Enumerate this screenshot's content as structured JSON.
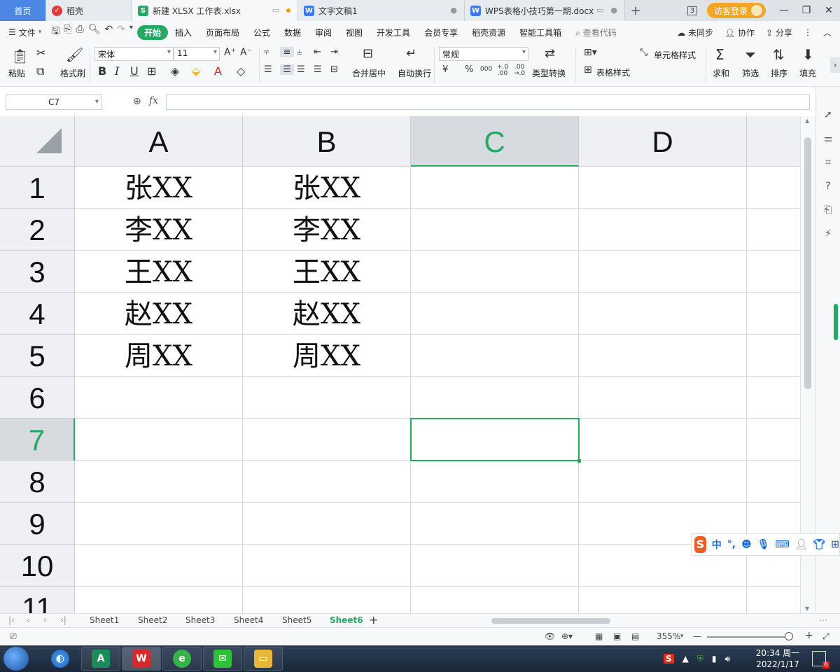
{
  "tabs": [
    {
      "label": "首页",
      "icon": "home-icon"
    },
    {
      "label": "稻壳",
      "icon": "daoke-icon"
    },
    {
      "label": "新建 XLSX 工作表.xlsx",
      "icon": "sheet-s-icon"
    },
    {
      "label": "文字文稿1",
      "icon": "writer-w-icon"
    },
    {
      "label": "WPS表格小技巧第一期.docx",
      "icon": "writer-w-icon"
    }
  ],
  "tabbar": {
    "window_count": "3",
    "login_label": "访客登录"
  },
  "menu": {
    "file_label": "文件",
    "items": [
      "开始",
      "插入",
      "页面布局",
      "公式",
      "数据",
      "审阅",
      "视图",
      "开发工具",
      "会员专享",
      "稻壳资源",
      "智能工具箱"
    ],
    "search_label": "查看代码",
    "right_items": [
      "未同步",
      "协作",
      "分享"
    ]
  },
  "ribbon": {
    "paste_label": "粘贴",
    "format_painter_label": "格式刷",
    "font_name": "宋体",
    "font_size": "11",
    "merge_label": "合并居中",
    "wrap_label": "自动换行",
    "number_format": "常规",
    "convert_label": "类型转换",
    "cell_style_label": "单元格样式",
    "table_style_label": "表格样式",
    "sum_label": "求和",
    "filter_label": "筛选",
    "sort_label": "排序",
    "fill_label": "填充",
    "bold": "B",
    "italic": "I",
    "underline": "U",
    "currency": "¥",
    "percent": "%",
    "thousands": "000",
    "inc_decimal": "+.0\n.00",
    "dec_decimal": ".00\n→.0"
  },
  "formula_bar": {
    "cell_ref": "C7",
    "fx": "fx",
    "value": ""
  },
  "sheet": {
    "columns": [
      "A",
      "B",
      "C",
      "D"
    ],
    "selected_column": "C",
    "rows": [
      "1",
      "2",
      "3",
      "4",
      "5",
      "6",
      "7",
      "8",
      "9",
      "10",
      "11"
    ],
    "selected_row": "7",
    "cells": [
      [
        "张XX",
        "张XX",
        "",
        ""
      ],
      [
        "李XX",
        "李XX",
        "",
        ""
      ],
      [
        "王XX",
        "王XX",
        "",
        ""
      ],
      [
        "赵XX",
        "赵XX",
        "",
        ""
      ],
      [
        "周XX",
        "周XX",
        "",
        ""
      ],
      [
        "",
        "",
        "",
        ""
      ],
      [
        "",
        "",
        "",
        ""
      ],
      [
        "",
        "",
        "",
        ""
      ],
      [
        "",
        "",
        "",
        ""
      ],
      [
        "",
        "",
        "",
        ""
      ],
      [
        "",
        "",
        "",
        ""
      ]
    ],
    "active_cell": "C7"
  },
  "sheet_tabs": [
    "Sheet1",
    "Sheet2",
    "Sheet3",
    "Sheet4",
    "Sheet5",
    "Sheet6"
  ],
  "active_sheet": "Sheet6",
  "status": {
    "zoom": "355%"
  },
  "ime": {
    "lang": "中",
    "punct": "°,"
  },
  "taskbar": {
    "time": "20:34 周一",
    "date": "2022/1/17",
    "notify_count": "6"
  },
  "colors": {
    "accent": "#27a866",
    "home_tab": "#4d87e6",
    "login": "#f5a623"
  }
}
